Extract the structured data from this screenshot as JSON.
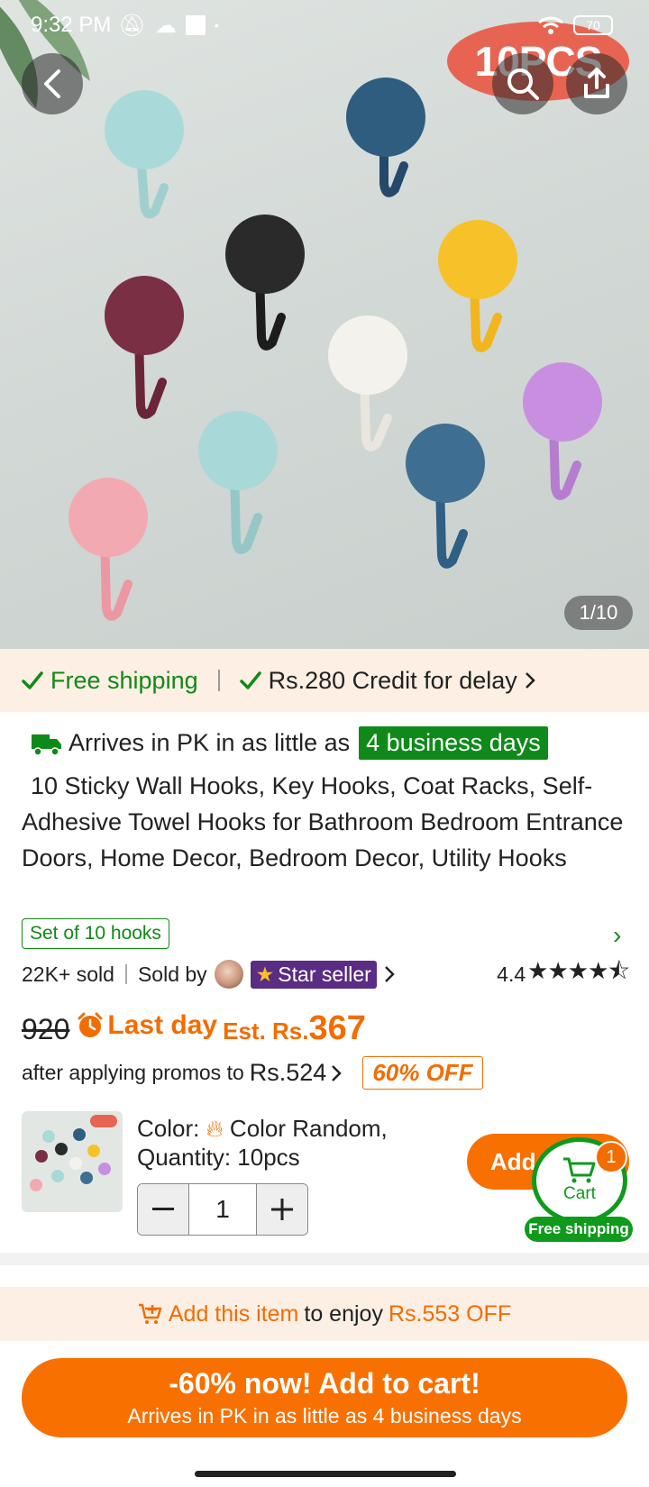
{
  "status_bar": {
    "time": "9:32 PM",
    "battery": "70"
  },
  "hero": {
    "badge": "10PCS",
    "pager": "1/10",
    "hook_colors": [
      "#a8d8d8",
      "#2f5d80",
      "#2a2a2a",
      "#f7c12a",
      "#7a2f45",
      "#f2f0ea",
      "#a8d8d8",
      "#3e6f92",
      "#c88fe0",
      "#f3a9b2"
    ]
  },
  "shipping": {
    "free": "Free shipping",
    "credit": "Rs.280 Credit for delay"
  },
  "arrive": {
    "prefix": "Arrives in PK in as little as",
    "days": "4 business days"
  },
  "product": {
    "title": "10 Sticky Wall Hooks, Key Hooks, Coat Racks, Self-Adhesive Towel Hooks for Bathroom Bedroom Entrance Doors, Home Decor, Bedroom Decor, Utility Hooks",
    "tag": "Set of 10 hooks"
  },
  "sold": {
    "count": "22K+ sold",
    "sold_by": "Sold by",
    "seller": "Star seller",
    "rating": "4.4",
    "stars": "★★★★⯪"
  },
  "price": {
    "old": "920",
    "last_day": "Last day",
    "est": "Est. Rs.",
    "current": "367",
    "promo_text": "after applying promos to",
    "promo_amount": "Rs.524",
    "off": "60% OFF"
  },
  "sku": {
    "color_line": "Color:",
    "color_value": "Color Random,",
    "quantity_line": "Quantity: 10pcs",
    "qty": "1",
    "add_label": "Add t"
  },
  "cart": {
    "label": "Cart",
    "count": "1",
    "free": "Free shipping"
  },
  "add_promo": {
    "lead": "Add this item",
    "mid": "to enjoy",
    "amount": "Rs.553 OFF"
  },
  "cta": {
    "line1": "-60% now! Add to cart!",
    "line2": "Arrives in PK in as little as 4 business days"
  },
  "colors": {
    "accent": "#f87000",
    "green": "#108a17",
    "seller_purple": "#5b2c83"
  }
}
